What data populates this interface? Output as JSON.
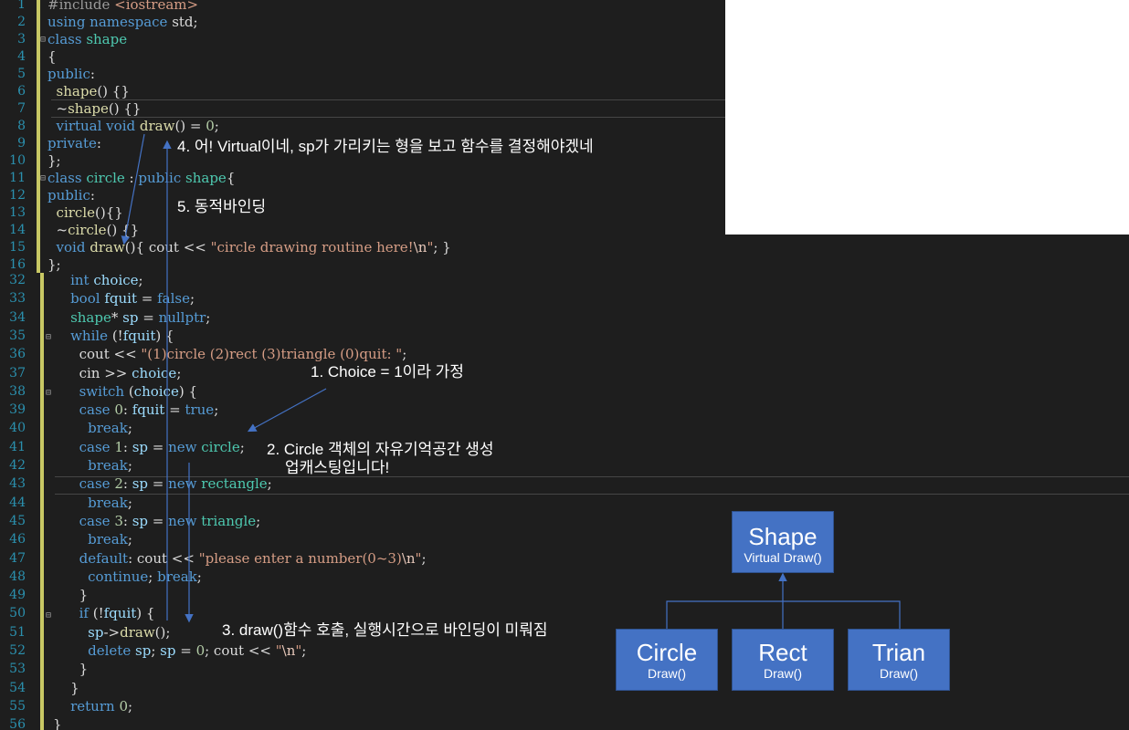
{
  "top_pane": {
    "lines": [
      {
        "n": "1",
        "html": "<span class='mac'>#include</span> <span class='inc'>&lt;iostream&gt;</span>"
      },
      {
        "n": "2",
        "html": "<span class='kw'>using namespace</span> std;"
      },
      {
        "n": "3",
        "html": "<span class='kw'>class</span> <span class='ty'>shape</span>"
      },
      {
        "n": "4",
        "html": "{"
      },
      {
        "n": "5",
        "html": "<span class='kw'>public</span>:"
      },
      {
        "n": "6",
        "html": "  <span class='fn'>shape</span>() {}"
      },
      {
        "n": "7",
        "html": "  ~<span class='fn'>shape</span>() {}"
      },
      {
        "n": "8",
        "html": "  <span class='kw'>virtual void</span> <span class='fn'>draw</span>() = <span class='num'>0</span>;"
      },
      {
        "n": "9",
        "html": "<span class='kw'>private</span>:"
      },
      {
        "n": "10",
        "html": "};"
      },
      {
        "n": "11",
        "html": "<span class='kw'>class</span> <span class='ty'>circle</span> : <span class='kw'>public</span> <span class='ty'>shape</span>{"
      },
      {
        "n": "12",
        "html": "<span class='kw'>public</span>:"
      },
      {
        "n": "13",
        "html": "  <span class='fn'>circle</span>(){}"
      },
      {
        "n": "14",
        "html": "  ~<span class='fn'>circle</span>() {}"
      },
      {
        "n": "15",
        "html": "  <span class='kw'>void</span> <span class='fn'>draw</span>(){ cout &lt;&lt; <span class='str'>\"circle drawing routine here!</span><span class='esc'>\\n</span><span class='str'>\"</span>; }"
      },
      {
        "n": "16",
        "html": "};"
      }
    ]
  },
  "bottom_pane": {
    "lines": [
      {
        "n": "32",
        "html": "    <span class='kw'>int</span> <span class='var'>choice</span>;"
      },
      {
        "n": "33",
        "html": "    <span class='kw'>bool</span> <span class='var'>fquit</span> = <span class='kw'>false</span>;"
      },
      {
        "n": "34",
        "html": "    <span class='ty'>shape</span>* <span class='var'>sp</span> = <span class='kw'>nullptr</span>;"
      },
      {
        "n": "35",
        "html": "    <span class='kw'>while</span> (!<span class='var'>fquit</span>) {"
      },
      {
        "n": "36",
        "html": "      cout &lt;&lt; <span class='str'>\"(1)circle (2)rect (3)triangle (0)quit: \"</span>;"
      },
      {
        "n": "37",
        "html": "      cin &gt;&gt; <span class='var'>choice</span>;"
      },
      {
        "n": "38",
        "html": "      <span class='kw'>switch</span> (<span class='var'>choice</span>) {"
      },
      {
        "n": "39",
        "html": "      <span class='kw'>case</span> <span class='num'>0</span>: <span class='var'>fquit</span> = <span class='kw'>true</span>;"
      },
      {
        "n": "40",
        "html": "        <span class='kw'>break</span>;"
      },
      {
        "n": "41",
        "html": "      <span class='kw'>case</span> <span class='num'>1</span>: <span class='var'>sp</span> = <span class='kw'>new</span> <span class='ty'>circle</span>;"
      },
      {
        "n": "42",
        "html": "        <span class='kw'>break</span>;"
      },
      {
        "n": "43",
        "html": "      <span class='kw'>case</span> <span class='num'>2</span>: <span class='var'>sp</span> = <span class='kw'>new</span> <span class='ty'>rectangle</span>;"
      },
      {
        "n": "44",
        "html": "        <span class='kw'>break</span>;"
      },
      {
        "n": "45",
        "html": "      <span class='kw'>case</span> <span class='num'>3</span>: <span class='var'>sp</span> = <span class='kw'>new</span> <span class='ty'>triangle</span>;"
      },
      {
        "n": "46",
        "html": "        <span class='kw'>break</span>;"
      },
      {
        "n": "47",
        "html": "      <span class='kw'>default</span>: cout &lt;&lt; <span class='str'>\"please enter a number(0~3)</span><span class='esc'>\\n</span><span class='str'>\"</span>;"
      },
      {
        "n": "48",
        "html": "        <span class='kw'>continue</span>; <span class='kw'>break</span>;"
      },
      {
        "n": "49",
        "html": "      }"
      },
      {
        "n": "50",
        "html": "      <span class='kw'>if</span> (!<span class='var'>fquit</span>) {"
      },
      {
        "n": "51",
        "html": "        <span class='var'>sp</span>-&gt;<span class='fn'>draw</span>();"
      },
      {
        "n": "52",
        "html": "        <span class='kw'>delete</span> <span class='var'>sp</span>; <span class='var'>sp</span> = <span class='num'>0</span>; cout &lt;&lt; <span class='str'>\"</span><span class='esc'>\\n</span><span class='str'>\"</span>;"
      },
      {
        "n": "53",
        "html": "      }"
      },
      {
        "n": "54",
        "html": "    }"
      },
      {
        "n": "55",
        "html": "    <span class='kw'>return</span> <span class='num'>0</span>;"
      },
      {
        "n": "56",
        "html": "}"
      }
    ]
  },
  "annotations": {
    "a1": "1. Choice = 1이라 가정",
    "a2_line1": "2. Circle 객체의 자유기억공간 생성",
    "a2_line2": "업캐스팅입니다!",
    "a3": "3. draw()함수 호출, 실행시간으로 바인딩이 미뤄짐",
    "a4": "4. 어! Virtual이네, sp가 가리키는 형을 보고 함수를 결정해야겠네",
    "a5": "5. 동적바인딩"
  },
  "diagram": {
    "root": {
      "title": "Shape",
      "sub": "Virtual Draw()"
    },
    "children": [
      {
        "title": "Circle",
        "sub": "Draw()"
      },
      {
        "title": "Rect",
        "sub": "Draw()"
      },
      {
        "title": "Trian",
        "sub": "Draw()"
      }
    ]
  },
  "colors": {
    "box": "#4472c4",
    "arrow": "#4472c4"
  }
}
